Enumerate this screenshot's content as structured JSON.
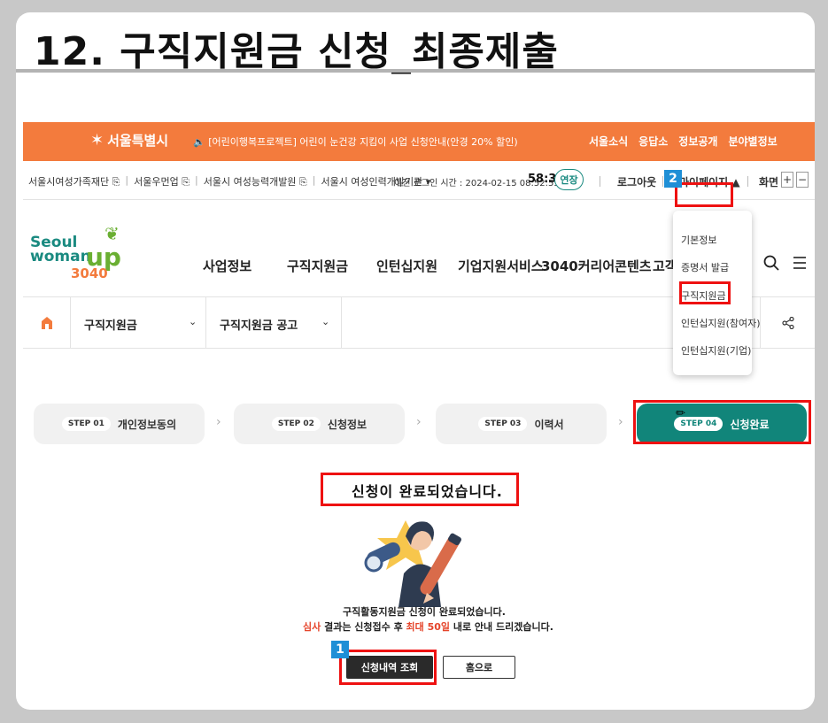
{
  "slide": {
    "title": "12. 구직지원금 신청_최종제출"
  },
  "topbar": {
    "logo_text": "서울특별시",
    "notice": "🔈 [어린이행복프로젝트] 어린이 눈건강 지킴이 사업 신청안내(안경 20% 할인)",
    "links": [
      "서울소식",
      "응답소",
      "정보공개",
      "분야별정보"
    ]
  },
  "utilbar": {
    "links": [
      "서울시여성가족재단 ⎘",
      "서울우먼업 ⎘",
      "서울시 여성능력개발원 ⎘",
      "서울시 여성인력개발기관 ▾"
    ],
    "last_login": "이전 로그인 시간 : 2024-02-15 08:52:53.0",
    "timer": "58:37",
    "extend_label": "연장",
    "logout_label": "로그아웃",
    "mypage_label": "마이페이지 ▲",
    "zoom_label": "화면",
    "zoom_in": "+",
    "zoom_out": "−"
  },
  "brand": {
    "line1": "Seoul",
    "line2": "woman",
    "up": "up",
    "num": "3040"
  },
  "nav": {
    "items": [
      "사업정보",
      "구직지원금",
      "인턴십지원",
      "기업지원서비스",
      "3040커리어콘텐츠",
      "고객지"
    ]
  },
  "breadcrumb": {
    "level1": "구직지원금",
    "level2": "구직지원금 공고",
    "chevron": "⌄"
  },
  "dropdown": {
    "items": [
      "기본정보",
      "증명서 발급",
      "구직지원금",
      "인턴십지원(참여자)",
      "인턴십지원(기업)"
    ]
  },
  "steps": [
    {
      "badge": "STEP 01",
      "label": "개인정보동의"
    },
    {
      "badge": "STEP 02",
      "label": "신청정보"
    },
    {
      "badge": "STEP 03",
      "label": "이력서"
    },
    {
      "badge": "STEP 04",
      "label": "신청완료"
    }
  ],
  "step_arrow": "›",
  "content": {
    "done_message": "신청이 완료되었습니다.",
    "info_line1": "구직활동지원금 신청이 완료되었습니다.",
    "info_line2_a": "심사",
    "info_line2_b": " 결과는 신청접수 후 ",
    "info_line2_c": "최대 50일",
    "info_line2_d": " 내로 안내 드리겠습니다."
  },
  "buttons": {
    "history": "신청내역 조회",
    "home": "홈으로"
  },
  "markers": {
    "one": "1",
    "two": "2"
  },
  "colors": {
    "orange_bar": "#f37b3d",
    "teal": "#11857a",
    "highlight": "#ee1111",
    "marker_blue": "#1f8fd6"
  }
}
